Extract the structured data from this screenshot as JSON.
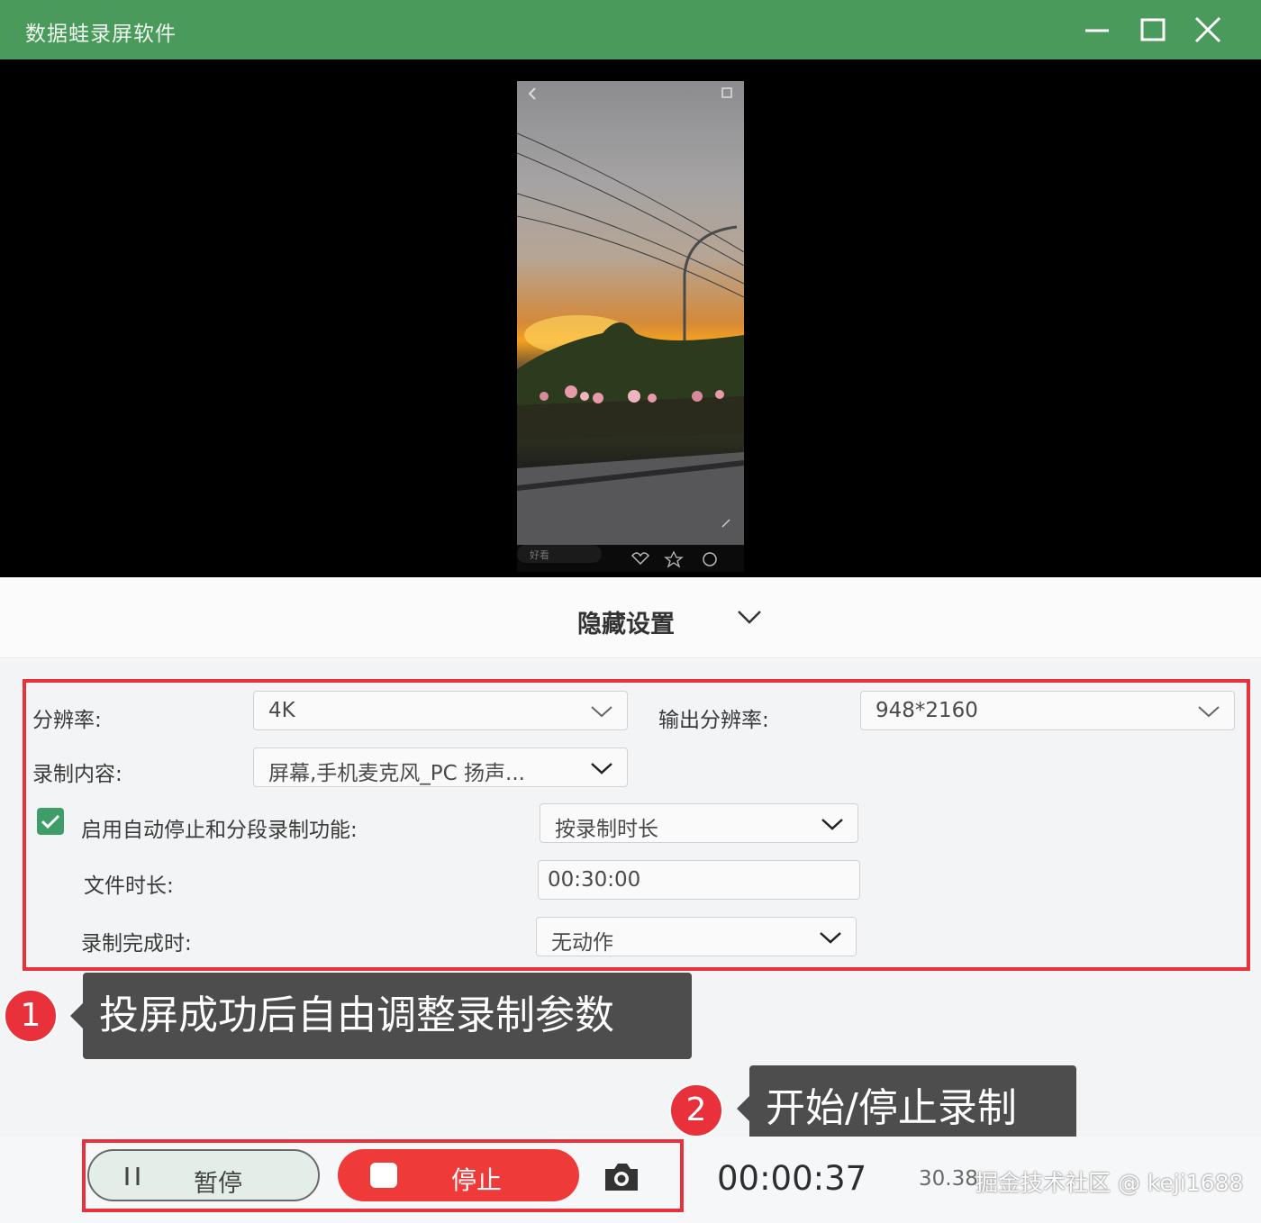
{
  "app": {
    "title": "数据蛙录屏软件"
  },
  "preview": {
    "phone_caption": "好看",
    "phone_icons": [
      "back-icon",
      "share-icon",
      "heart-icon",
      "star-icon",
      "comment-icon"
    ]
  },
  "settings_toggle": {
    "label": "隐藏设置"
  },
  "settings": {
    "resolution_label": "分辨率:",
    "resolution_value": "4K",
    "output_resolution_label": "输出分辨率:",
    "output_resolution_value": "948*2160",
    "content_label": "录制内容:",
    "content_value": "屏幕,手机麦克风_PC 扬声...",
    "auto_stop_label": "启用自动停止和分段录制功能:",
    "auto_stop_checked": true,
    "auto_stop_mode": "按录制时长",
    "file_duration_label": "文件时长:",
    "file_duration_value": "00:30:00",
    "on_complete_label": "录制完成时:",
    "on_complete_value": "无动作"
  },
  "callouts": [
    {
      "number": "1",
      "text": "投屏成功后自由调整录制参数"
    },
    {
      "number": "2",
      "text": "开始/停止录制"
    }
  ],
  "controls": {
    "pause_label": "暂停",
    "stop_label": "停止",
    "timer": "00:00:37",
    "file_size": "30.38",
    "watermark": "掘金技术社区 @ keji1688"
  },
  "colors": {
    "titlebar": "#4a9a5c",
    "accent_red": "#e8313b",
    "stop_button": "#ef3a3a",
    "checkbox": "#3f9e68",
    "callout_bg": "#4d4d4d"
  }
}
